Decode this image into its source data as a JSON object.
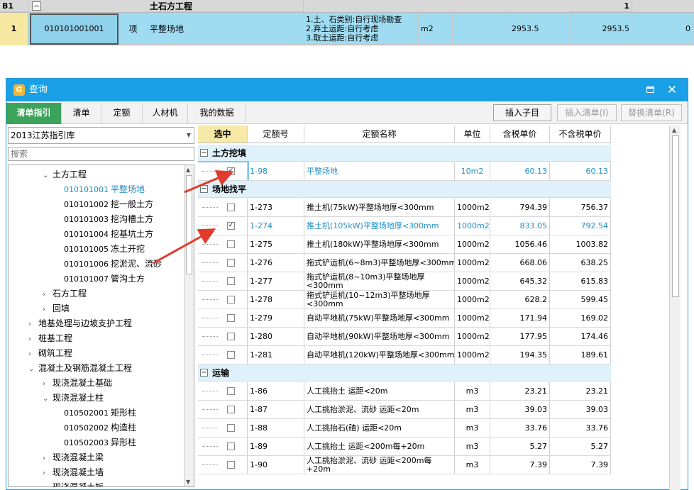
{
  "sheet": {
    "section_row": {
      "code": "B1",
      "toggle": "−",
      "name": "土石方工程",
      "qty": "1"
    },
    "item_row": {
      "index": "1",
      "code": "010101001001",
      "unit_type": "项",
      "name": "平整场地",
      "features": [
        "1.土、石类别:自行现场勘查",
        "2.弃土运距:自行考虑",
        "3.取土运距:自行考虑"
      ],
      "unit": "m2",
      "qty": "2953.5",
      "amount": "2953.5",
      "last": "0"
    }
  },
  "dialog": {
    "title": "查询",
    "title_icon": "app-icon",
    "maximize_icon": "maximize-icon",
    "close_icon": "close-icon",
    "tabs": [
      "清单指引",
      "清单",
      "定额",
      "人材机",
      "我的数据"
    ],
    "buttons": {
      "insert_child": "插入子目",
      "insert_list": "插入清单(I)",
      "replace_list": "替换清单(R)"
    }
  },
  "left": {
    "library": "2013江苏指引库",
    "search_placeholder": "搜索",
    "tree": [
      {
        "arrow": "⌄",
        "code": "",
        "label": "土方工程"
      },
      {
        "arrow": "",
        "code": "010101001",
        "label": "平整场地",
        "selected": true
      },
      {
        "arrow": "",
        "code": "010101002",
        "label": "挖一般土方"
      },
      {
        "arrow": "",
        "code": "010101003",
        "label": "挖沟槽土方"
      },
      {
        "arrow": "",
        "code": "010101004",
        "label": "挖基坑土方"
      },
      {
        "arrow": "",
        "code": "010101005",
        "label": "冻土开挖"
      },
      {
        "arrow": "",
        "code": "010101006",
        "label": "挖淤泥、流砂"
      },
      {
        "arrow": "",
        "code": "010101007",
        "label": "管沟土方"
      },
      {
        "arrow": "›",
        "code": "",
        "label": "石方工程"
      },
      {
        "arrow": "›",
        "code": "",
        "label": "回填"
      },
      {
        "arrow": "›",
        "code": "",
        "label": "地基处理与边坡支护工程"
      },
      {
        "arrow": "›",
        "code": "",
        "label": "桩基工程"
      },
      {
        "arrow": "›",
        "code": "",
        "label": "砌筑工程"
      },
      {
        "arrow": "⌄",
        "code": "",
        "label": "混凝土及钢筋混凝土工程"
      },
      {
        "arrow": "›",
        "code": "",
        "label": "现浇混凝土基础"
      },
      {
        "arrow": "⌄",
        "code": "",
        "label": "现浇混凝土柱"
      },
      {
        "arrow": "",
        "code": "010502001",
        "label": "矩形柱"
      },
      {
        "arrow": "",
        "code": "010502002",
        "label": "构造柱"
      },
      {
        "arrow": "",
        "code": "010502003",
        "label": "异形柱"
      },
      {
        "arrow": "›",
        "code": "",
        "label": "现浇混凝土梁"
      },
      {
        "arrow": "›",
        "code": "",
        "label": "现浇混凝土墙"
      },
      {
        "arrow": "›",
        "code": "",
        "label": "现浇混凝土板"
      }
    ]
  },
  "grid": {
    "headers": [
      "选中",
      "定额号",
      "定额名称",
      "单位",
      "含税单价",
      "不含税单价"
    ],
    "groups": [
      {
        "name": "土方挖填",
        "rows": [
          {
            "checked": true,
            "code": "1-98",
            "name": "平整场地",
            "unit": "10m2",
            "tax": "60.13",
            "notax": "60.13",
            "highlight": true
          }
        ]
      },
      {
        "name": "场地找平",
        "rows": [
          {
            "checked": false,
            "code": "1-273",
            "name": "推土机(75kW)平整场地厚<300mm",
            "unit": "1000m2",
            "tax": "794.39",
            "notax": "756.37"
          },
          {
            "checked": true,
            "code": "1-274",
            "name": "推土机(105kW)平整场地厚<300mm",
            "unit": "1000m2",
            "tax": "833.05",
            "notax": "792.54",
            "highlight": true
          },
          {
            "checked": false,
            "code": "1-275",
            "name": "推土机(180kW)平整场地厚<300mm",
            "unit": "1000m2",
            "tax": "1056.46",
            "notax": "1003.82"
          },
          {
            "checked": false,
            "code": "1-276",
            "name": "拖式铲运机(6~8m3)平整场地厚<300mm",
            "unit": "1000m2",
            "tax": "668.06",
            "notax": "638.25"
          },
          {
            "checked": false,
            "code": "1-277",
            "name": "拖式铲运机(8~10m3)平整场地厚<300mm",
            "unit": "1000m2",
            "tax": "645.32",
            "notax": "615.83",
            "tall": true
          },
          {
            "checked": false,
            "code": "1-278",
            "name": "拖式铲运机(10~12m3)平整场地厚<300mm",
            "unit": "1000m2",
            "tax": "628.2",
            "notax": "599.45",
            "tall": true
          },
          {
            "checked": false,
            "code": "1-279",
            "name": "自动平地机(75kW)平整场地厚<300mm",
            "unit": "1000m2",
            "tax": "171.94",
            "notax": "169.02"
          },
          {
            "checked": false,
            "code": "1-280",
            "name": "自动平地机(90kW)平整场地厚<300mm",
            "unit": "1000m2",
            "tax": "177.95",
            "notax": "174.46"
          },
          {
            "checked": false,
            "code": "1-281",
            "name": "自动平地机(120kW)平整场地厚<300mm",
            "unit": "1000m2",
            "tax": "194.35",
            "notax": "189.61"
          }
        ]
      },
      {
        "name": "运输",
        "rows": [
          {
            "checked": false,
            "code": "1-86",
            "name": "人工挑抬土 运距<20m",
            "unit": "m3",
            "tax": "23.21",
            "notax": "23.21"
          },
          {
            "checked": false,
            "code": "1-87",
            "name": "人工挑抬淤泥、流砂 运距<20m",
            "unit": "m3",
            "tax": "39.03",
            "notax": "39.03"
          },
          {
            "checked": false,
            "code": "1-88",
            "name": "人工挑抬石(碴) 运距<20m",
            "unit": "m3",
            "tax": "33.76",
            "notax": "33.76"
          },
          {
            "checked": false,
            "code": "1-89",
            "name": "人工挑抬土 运距<200m每+20m",
            "unit": "m3",
            "tax": "5.27",
            "notax": "5.27"
          },
          {
            "checked": false,
            "code": "1-90",
            "name": "人工挑抬淤泥、流砂 运距<200m每+20m",
            "unit": "m3",
            "tax": "7.39",
            "notax": "7.39",
            "tall": true
          }
        ]
      }
    ]
  },
  "colors": {
    "title_bar": "#1aa0e6",
    "active_tab": "#3ba35a",
    "group_bg": "#dff1fb",
    "link_blue": "#1f8fc8",
    "arrow_red": "#e23b2e",
    "selected_row": "#9fdcf2"
  }
}
